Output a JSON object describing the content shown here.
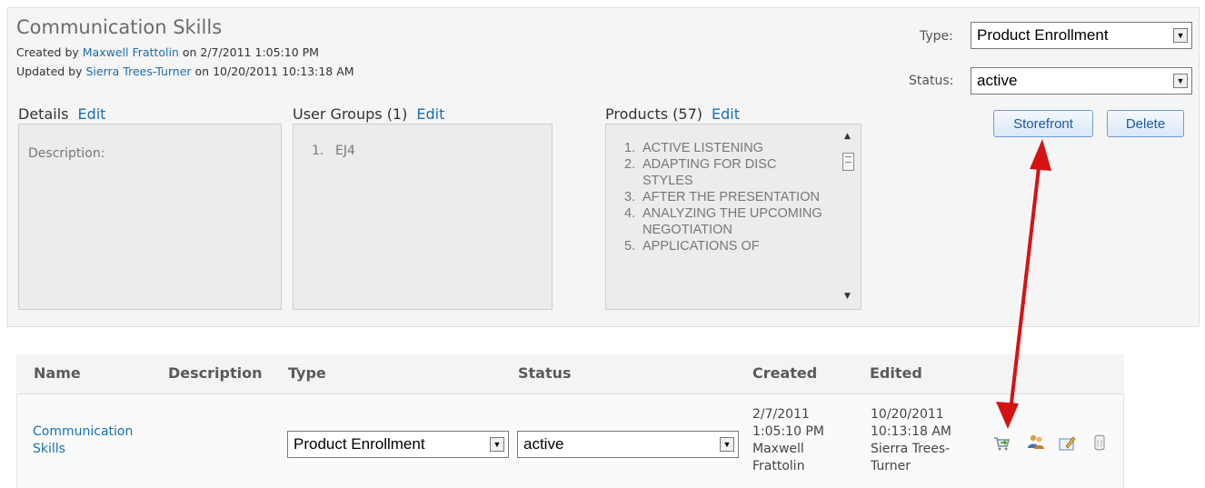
{
  "header": {
    "title": "Communication Skills",
    "created_prefix": "Created by",
    "created_by": "Maxwell Frattolin",
    "created_on": "on 2/7/2011 1:05:10 PM",
    "updated_prefix": "Updated by",
    "updated_by": "Sierra Trees-Turner",
    "updated_on": "on 10/20/2011 10:13:18 AM"
  },
  "details": {
    "label": "Details",
    "edit": "Edit",
    "description_label": "Description:"
  },
  "user_groups": {
    "label": "User Groups (1)",
    "edit": "Edit",
    "items": [
      {
        "num": "1.",
        "name": "EJ4"
      }
    ]
  },
  "products": {
    "label": "Products (57)",
    "edit": "Edit",
    "items": [
      {
        "num": "1.",
        "name": "ACTIVE LISTENING"
      },
      {
        "num": "2.",
        "name": "ADAPTING FOR DISC STYLES"
      },
      {
        "num": "3.",
        "name": "AFTER THE PRESENTATION"
      },
      {
        "num": "4.",
        "name": "ANALYZING THE UPCOMING NEGOTIATION"
      },
      {
        "num": "5.",
        "name": "APPLICATIONS OF"
      }
    ]
  },
  "form": {
    "type_label": "Type:",
    "type_value": "Product Enrollment",
    "status_label": "Status:",
    "status_value": "active"
  },
  "buttons": {
    "storefront": "Storefront",
    "delete": "Delete"
  },
  "table": {
    "headers": {
      "name": "Name",
      "description": "Description",
      "type": "Type",
      "status": "Status",
      "created": "Created",
      "edited": "Edited"
    },
    "row": {
      "name_line1": "Communication",
      "name_line2": "Skills",
      "type": "Product Enrollment",
      "status": "active",
      "created": [
        "2/7/2011",
        "1:05:10 PM",
        "Maxwell",
        "Frattolin"
      ],
      "edited": [
        "10/20/2011",
        "10:13:18 AM",
        "Sierra Trees-",
        "Turner"
      ],
      "actions": [
        "storefront-cart-icon",
        "user-group-icon",
        "edit-note-icon",
        "delete-trash-icon"
      ]
    }
  },
  "colors": {
    "link": "#1a6fb3",
    "annotation_arrow": "#d41313",
    "button_border": "#6f9cd0"
  }
}
